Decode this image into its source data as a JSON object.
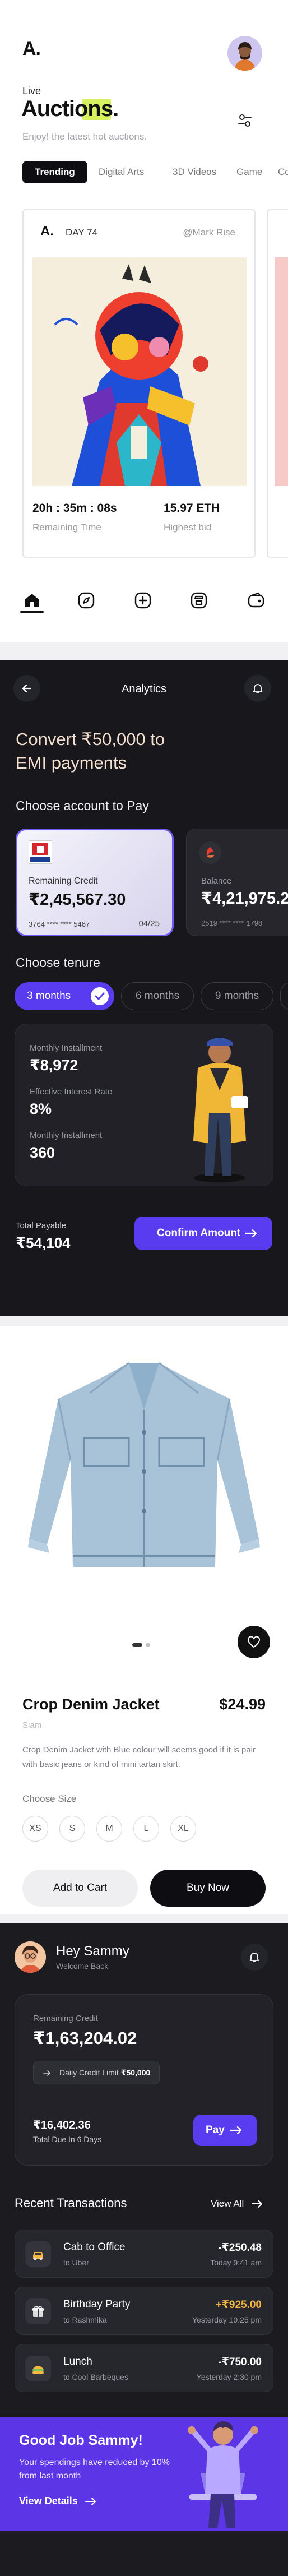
{
  "auctions_screen": {
    "logo": "A.",
    "eyebrow": "Live",
    "title": "Auctions.",
    "subtitle": "Enjoy! the latest hot auctions.",
    "tabs": [
      "Trending",
      "Digital Arts",
      "3D Videos",
      "Game",
      "Co"
    ],
    "card": {
      "logo": "A.",
      "day": "DAY 74",
      "creator": "@Mark Rise",
      "time_value": "20h : 35m : 08s",
      "time_label": "Remaining Time",
      "bid_value": "15.97 ETH",
      "bid_label": "Highest bid"
    },
    "bottom_nav_icons": [
      "home-icon",
      "compass-icon",
      "add-icon",
      "store-icon",
      "wallet-icon"
    ],
    "colors": {
      "accent": "#0d0d12",
      "highlight": "#d6f260"
    }
  },
  "emi_screen": {
    "header_title": "Analytics",
    "headline": "Convert ₹50,000 to EMI payments",
    "choose_account": "Choose account to Pay",
    "accounts": [
      {
        "label": "Remaining Credit",
        "amount": "₹2,45,567.30",
        "number": "3764 **** **** 5467",
        "expiry": "04/25",
        "bank": "HDFC BANK"
      },
      {
        "label": "Balance",
        "amount": "₹4,21,975.2",
        "number": "2519 **** **** 1798"
      }
    ],
    "choose_tenure": "Choose tenure",
    "tenures": [
      "3 months",
      "6 months",
      "9 months"
    ],
    "summary": {
      "monthly_installment_label": "Monthly Installment",
      "monthly_installment_value": "₹8,972",
      "interest_label": "Effective Interest Rate",
      "interest_value": "8%",
      "months_label": "Monthly Installment",
      "months_value": "360"
    },
    "total_label": "Total Payable",
    "total_value": "₹54,104",
    "confirm_label": "Confirm Amount",
    "colors": {
      "accent": "#5a3cf0",
      "background": "#17171c"
    }
  },
  "product_screen": {
    "name": "Crop Denim Jacket",
    "price": "$24.99",
    "brand": "Siam",
    "description": "Crop Denim Jacket with Blue colour will seems good if it is pair with basic jeans or kind of mini tartan skirt.",
    "size_heading": "Choose Size",
    "sizes": [
      "XS",
      "S",
      "M",
      "L",
      "XL"
    ],
    "add_to_cart": "Add to Cart",
    "buy_now": "Buy Now"
  },
  "wallet_screen": {
    "greeting": "Hey Sammy",
    "welcome": "Welcome Back",
    "remaining_credit_label": "Remaining Credit",
    "remaining_credit_value": "₹1,63,204.02",
    "daily_limit_prefix": "Daily Credit Limit",
    "daily_limit_value": "₹50,000",
    "due_value": "₹16,402.36",
    "due_label": "Total Due In 6 Days",
    "pay_label": "Pay",
    "recent_heading": "Recent Transactions",
    "view_all": "View All",
    "transactions": [
      {
        "title": "Cab to Office",
        "sub": "to Uber",
        "amount": "-₹250.48",
        "time": "Today 9:41 am",
        "icon": "car-icon"
      },
      {
        "title": "Birthday Party",
        "sub": "to Rashmika",
        "amount": "+₹925.00",
        "time": "Yesterday 10:25 pm",
        "icon": "gift-icon"
      },
      {
        "title": "Lunch",
        "sub": "to Cool Barbeques",
        "amount": "-₹750.00",
        "time": "Yesterday 2:30 pm",
        "icon": "food-icon"
      }
    ],
    "promo_title": "Good Job Sammy!",
    "promo_text": "Your spendings have reduced by 10% from last month",
    "promo_link": "View Details",
    "colors": {
      "positive": "#f4b740",
      "promo": "#5b35e6"
    }
  }
}
